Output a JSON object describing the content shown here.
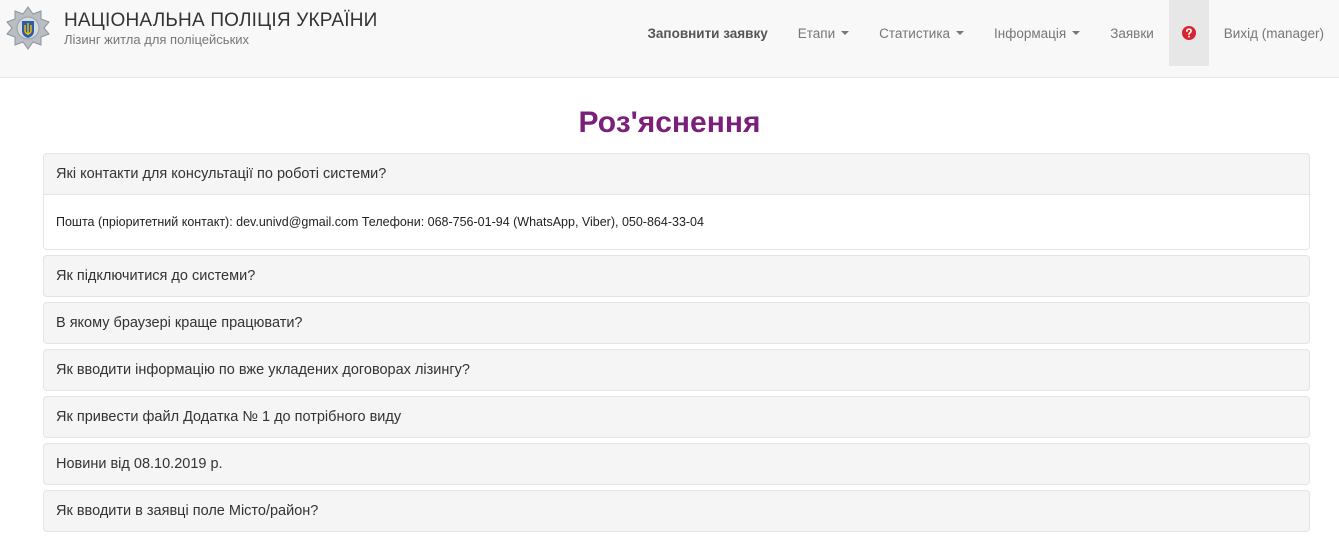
{
  "brand": {
    "title": "НАЦІОНАЛЬНА ПОЛІЦІЯ УКРАЇНИ",
    "subtitle": "Лізинг житла для поліцейських",
    "logo_icon": "police-badge-icon"
  },
  "nav": {
    "fill_request": "Заповнити заявку",
    "stages": "Етапи",
    "statistics": "Статистика",
    "information": "Інформація",
    "requests": "Заявки",
    "help_icon": "question-circle-icon",
    "logout": "Вихід (manager)"
  },
  "page": {
    "title": "Роз'яснення"
  },
  "faq": [
    {
      "question": "Які контакти для консультації по роботі системи?",
      "answer": "Пошта (пріоритетний контакт): dev.univd@gmail.com Телефони: 068-756-01-94 (WhatsApp, Viber), 050-864-33-04",
      "expanded": true
    },
    {
      "question": "Як підключитися до системи?",
      "expanded": false
    },
    {
      "question": "В якому браузері краще працювати?",
      "expanded": false
    },
    {
      "question": "Як вводити інформацію по вже укладених договорах лізингу?",
      "expanded": false
    },
    {
      "question": "Як привести файл Додатка № 1 до потрібного виду",
      "expanded": false
    },
    {
      "question": "Новини від 08.10.2019 р.",
      "expanded": false
    },
    {
      "question": "Як вводити в заявці поле Місто/район?",
      "expanded": false
    }
  ],
  "colors": {
    "title": "#7b1f7b",
    "help_icon": "#d9232d",
    "navbar_bg": "#f8f8f8",
    "panel_bg": "#f5f5f5"
  }
}
